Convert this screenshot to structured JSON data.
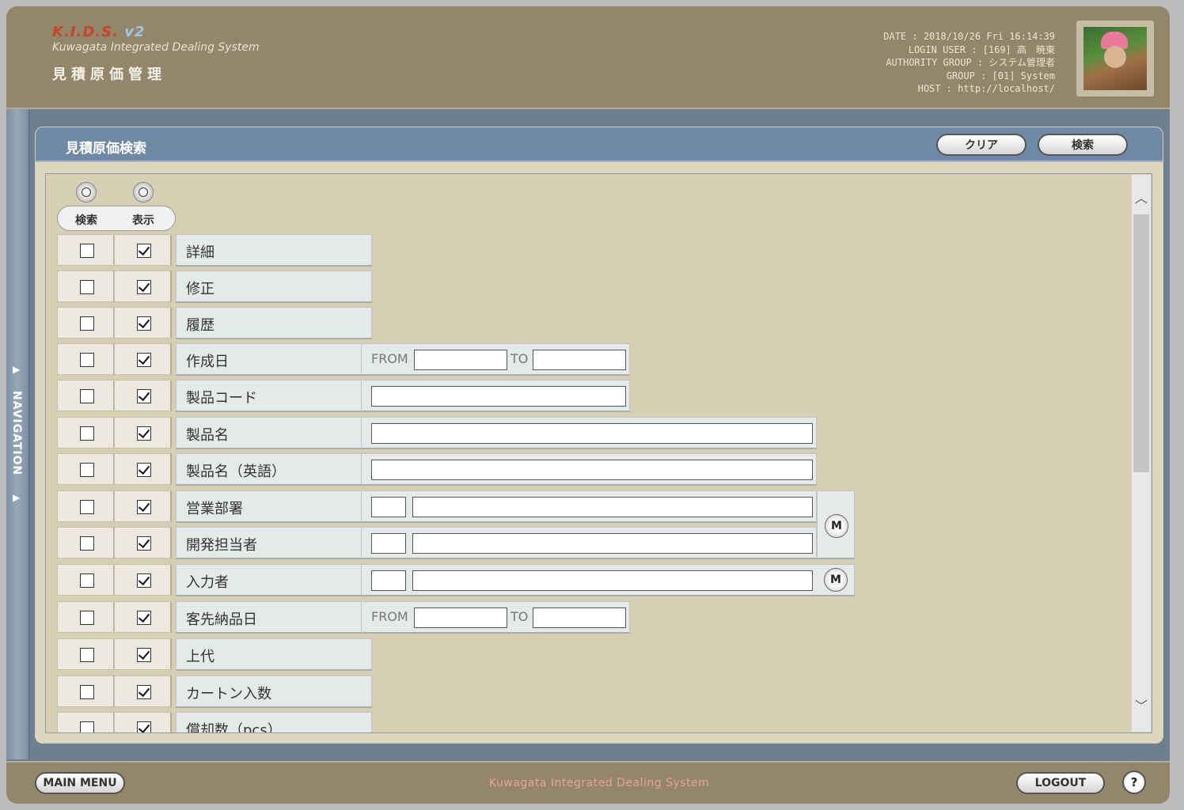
{
  "header": {
    "logo": "K.I.D.S.",
    "logo_version": "v2",
    "logo_subtitle": "Kuwagata Integrated Dealing System",
    "app_title": "見積原価管理",
    "date_line": "DATE : 2018/10/26 Fri 16:14:39",
    "login_line": "LOGIN USER : [169] 高　暁東",
    "authority_line": "AUTHORITY GROUP : システム管理者",
    "group_line": "GROUP : [01] System",
    "host_line": "HOST : http://localhost/"
  },
  "nav": {
    "label": "NAVIGATION"
  },
  "panel": {
    "title": "見積原価検索",
    "clear_label": "クリア",
    "search_label": "検索",
    "toggle": {
      "search_label": "検索",
      "display_label": "表示"
    },
    "from_label": "FROM",
    "to_label": "TO",
    "m_label": "M",
    "rows": [
      {
        "label": "詳細",
        "search": false,
        "display": true
      },
      {
        "label": "修正",
        "search": false,
        "display": true
      },
      {
        "label": "履歴",
        "search": false,
        "display": true
      },
      {
        "label": "作成日",
        "search": false,
        "display": true
      },
      {
        "label": "製品コード",
        "search": false,
        "display": true
      },
      {
        "label": "製品名",
        "search": false,
        "display": true
      },
      {
        "label": "製品名（英語）",
        "search": false,
        "display": true
      },
      {
        "label": "営業部署",
        "search": false,
        "display": true
      },
      {
        "label": "開発担当者",
        "search": false,
        "display": true
      },
      {
        "label": "入力者",
        "search": false,
        "display": true
      },
      {
        "label": "客先納品日",
        "search": false,
        "display": true
      },
      {
        "label": "上代",
        "search": false,
        "display": true
      },
      {
        "label": "カートン入数",
        "search": false,
        "display": true
      },
      {
        "label": "償却数（pcs）",
        "search": false,
        "display": true
      }
    ]
  },
  "footer": {
    "main_menu_label": "MAIN MENU",
    "system_name": "Kuwagata Integrated Dealing System",
    "logout_label": "LOGOUT",
    "help_label": "?"
  }
}
